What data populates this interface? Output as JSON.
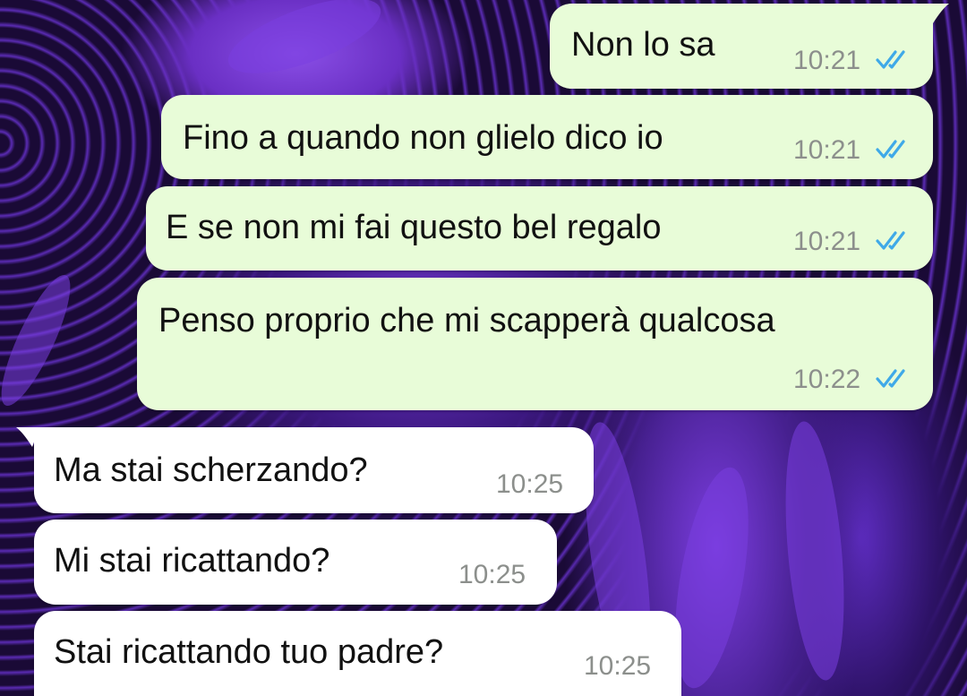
{
  "chat": {
    "messages": [
      {
        "direction": "outgoing",
        "text": "Non lo sa",
        "time": "10:21",
        "status": "read-double-check-icon"
      },
      {
        "direction": "outgoing",
        "text": "Fino a quando non glielo dico io",
        "time": "10:21",
        "status": "read-double-check-icon"
      },
      {
        "direction": "outgoing",
        "text": "E se non mi fai questo bel regalo",
        "time": "10:21",
        "status": "read-double-check-icon"
      },
      {
        "direction": "outgoing",
        "text": "Penso proprio che mi scapperà qualcosa",
        "time": "10:22",
        "status": "read-double-check-icon"
      },
      {
        "direction": "incoming",
        "text": "Ma stai scherzando?",
        "time": "10:25"
      },
      {
        "direction": "incoming",
        "text": "Mi stai ricattando?",
        "time": "10:25"
      },
      {
        "direction": "incoming",
        "text": "Stai ricattando tuo padre?",
        "time": "10:25"
      }
    ]
  },
  "colors": {
    "outgoing_bubble": "#e8fcd8",
    "incoming_bubble": "#ffffff",
    "read_tick": "#3fa9e8",
    "time_text": "#8c8f8c",
    "wallpaper_accent": "#6a2fc4"
  }
}
